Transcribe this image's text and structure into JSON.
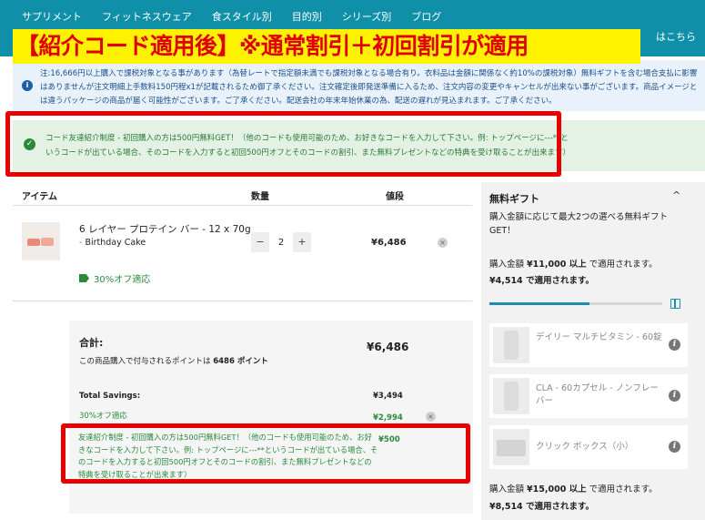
{
  "nav": {
    "items": [
      "サプリメント",
      "フィットネスウェア",
      "食スタイル別",
      "目的別",
      "シリーズ別",
      "ブログ"
    ],
    "right_link": "はこちら"
  },
  "banner": "【紹介コード適用後】※通常割引＋初回割引が適用",
  "notice": {
    "text": "注:16,666円以上購入で課税対象となる事があります（為替レートで指定額未満でも課税対象となる場合有り。衣料品は金額に関係なく約10%の課税対象）無料ギフトを含む場合支払に影響はありませんが注文明細上手数料150円程x1が記載されるため御了承ください。注文確定後即発送準備に入るため、注文内容の変更やキャンセルが出来ない事がございます。商品イメージとは違うパッケージの商品が届く可能性がございます。ご了承ください。配送会社の年末年始休業の為、配送の遅れが見込まれます。ご了承ください。"
  },
  "success": {
    "text": "コード友達紹介制度 - 初回購入の方は500円無料GET！（他のコードも使用可能のため、お好きなコードを入力して下さい。例: トップページに---**というコードが出ている場合、そのコードを入力すると初回500円オフとそのコードの割引、また無料プレゼントなどの特典を受け取ることが出来ます）"
  },
  "cart": {
    "headers": {
      "item": "アイテム",
      "qty": "数量",
      "price": "値段"
    },
    "item": {
      "name": "6 レイヤー プロテイン バー - 12 x 70g",
      "flavor_dash": "- ",
      "flavor": "Birthday Cake",
      "qty": "2",
      "minus": "−",
      "plus": "+",
      "price": "¥6,486",
      "remove": "×",
      "discount": "30%オフ適応"
    }
  },
  "totals": {
    "label": "合計:",
    "value": "¥6,486",
    "points_prefix": "この商品購入で付与されるポイントは ",
    "points_value": "6486 ポイント",
    "savings_label": "Total Savings:",
    "savings_value": "¥3,494",
    "discount_label": "30%オフ適応",
    "discount_value": "¥2,994",
    "referral_text": "友達紹介制度 - 初回購入の方は500円無料GET！（他のコードも使用可能のため、お好きなコードを入力して下さい。例: トップページに---**というコードが出ている場合、そのコードを入力すると初回500円オフとそのコードの割引、また無料プレゼントなどの特典を受け取ることが出来ます）",
    "referral_value": "¥500",
    "remove": "×"
  },
  "sidebar": {
    "title": "無料ギフト",
    "chevron": "^",
    "intro": "購入金額に応じて最大2つの選べる無料ギフトGET！",
    "tier1_line1_prefix": "購入金額 ",
    "tier1_amount": "¥11,000 以上",
    "tier1_line1_suffix": " で適用されます。",
    "tier1_remaining": "¥4,514",
    "tier1_remaining_suffix": " で適用されます。",
    "progress": 0.58,
    "gifts": [
      {
        "name": "デイリー マルチビタミン - 60錠",
        "info": "i"
      },
      {
        "name": "CLA - 60カプセル - ノンフレーバー",
        "info": "i"
      },
      {
        "name": "クリック ボックス（小）",
        "info": "i"
      }
    ],
    "tier2_line1_prefix": "購入金額 ",
    "tier2_amount": "¥15,000 以上",
    "tier2_line1_suffix": " で適用されます。",
    "tier2_remaining": "¥8,514",
    "tier2_remaining_suffix": " で適用されます。"
  },
  "colors": {
    "nav": "#0f8fa8",
    "accent_red": "#e60000",
    "banner_yellow": "#fff200",
    "green": "#2a8a3a"
  }
}
